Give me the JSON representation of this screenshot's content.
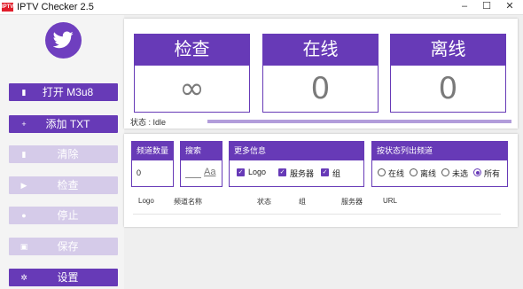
{
  "window": {
    "title": "IPTV Checker 2.5",
    "icon_text": "IPTV",
    "minimize_icon": "minimize-icon",
    "maximize_icon": "maximize-icon",
    "close_icon": "close-icon"
  },
  "sidebar": {
    "logo_icon": "twitter-bird-icon",
    "buttons": [
      {
        "label": "打开 M3u8",
        "icon": "file-icon",
        "glyph": "▮",
        "enabled": true
      },
      {
        "label": "添加 TXT",
        "icon": "plus-icon",
        "glyph": "+",
        "enabled": true
      },
      {
        "label": "清除",
        "icon": "trash-icon",
        "glyph": "▮",
        "enabled": false
      },
      {
        "label": "检查",
        "icon": "play-icon",
        "glyph": "▶",
        "enabled": false
      },
      {
        "label": "停止",
        "icon": "stop-icon",
        "glyph": "●",
        "enabled": false
      },
      {
        "label": "保存",
        "icon": "save-icon",
        "glyph": "▣",
        "enabled": false
      },
      {
        "label": "设置",
        "icon": "gear-icon",
        "glyph": "✲",
        "enabled": true
      }
    ]
  },
  "stats": [
    {
      "label": "检查",
      "value": "∞"
    },
    {
      "label": "在线",
      "value": "0"
    },
    {
      "label": "离线",
      "value": "0"
    }
  ],
  "status": {
    "text": "状态 : Idle",
    "progress": 1.0
  },
  "filters": {
    "channel_count": {
      "label": "频道数量",
      "value": "0"
    },
    "search": {
      "label": "搜索",
      "value": "",
      "case_icon": "Aa"
    },
    "more_info": {
      "label": "更多信息",
      "options": [
        {
          "label": "Logo",
          "checked": true
        },
        {
          "label": "服务器",
          "checked": true
        },
        {
          "label": "组",
          "checked": true
        }
      ]
    },
    "status_list": {
      "label": "按状态列出频道",
      "options": [
        {
          "label": "在线",
          "selected": false
        },
        {
          "label": "离线",
          "selected": false
        },
        {
          "label": "未选",
          "selected": false
        },
        {
          "label": "所有",
          "selected": true
        }
      ]
    }
  },
  "table": {
    "columns": [
      "Logo",
      "频道名称",
      "状态",
      "组",
      "服务器",
      "URL"
    ]
  },
  "colors": {
    "accent": "#673ab7",
    "disabled": "#d5cbe9",
    "background": "#efefef"
  }
}
